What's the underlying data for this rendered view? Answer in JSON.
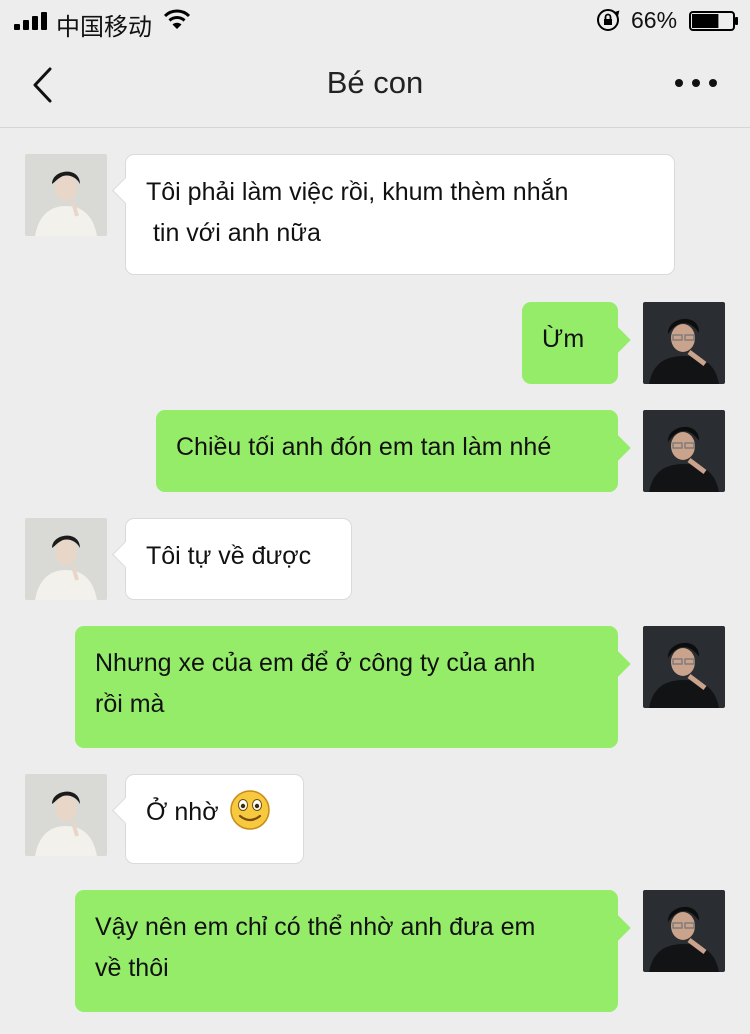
{
  "status_bar": {
    "carrier": "中国移动",
    "battery_percent": "66%",
    "battery_level": 0.66
  },
  "nav": {
    "title": "Bé con",
    "back_icon": "chevron-left-icon",
    "more_icon": "more-dots-icon"
  },
  "colors": {
    "incoming_bubble": "#ffffff",
    "outgoing_bubble": "#95ec69",
    "background": "#ededed"
  },
  "messages": [
    {
      "sender": "contact",
      "text": "Tôi phải làm việc rồi, khum thèm nhắn\n tin với anh nữa"
    },
    {
      "sender": "me",
      "text": "Ừm"
    },
    {
      "sender": "me",
      "text": "Chiều tối anh đón em tan làm nhé"
    },
    {
      "sender": "contact",
      "text": "Tôi tự về được"
    },
    {
      "sender": "me",
      "text": "Nhưng xe của em để ở công ty của anh\nrồi mà"
    },
    {
      "sender": "contact",
      "text": "Ở nhờ",
      "emoji": "smiley-emoji-icon"
    },
    {
      "sender": "me",
      "text": "Vậy nên em chỉ có thể nhờ anh đưa em\nvề thôi"
    }
  ]
}
